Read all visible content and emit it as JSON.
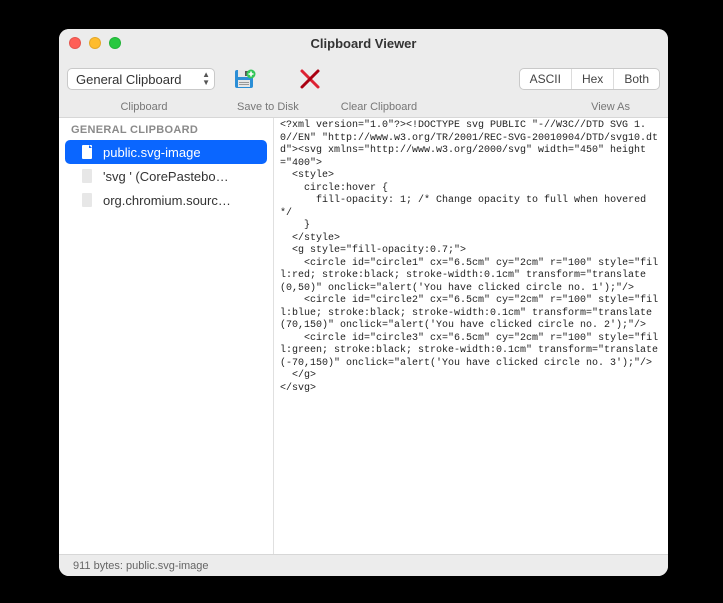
{
  "window": {
    "title": "Clipboard Viewer"
  },
  "toolbar": {
    "clipboard_select": "General Clipboard",
    "save_label": "Save to Disk",
    "clear_label": "Clear Clipboard",
    "label_clipboard": "Clipboard",
    "label_viewas": "View As",
    "viewas": {
      "ascii": "ASCII",
      "hex": "Hex",
      "both": "Both"
    }
  },
  "sidebar": {
    "header": "GENERAL CLIPBOARD",
    "items": [
      {
        "label": "public.svg-image",
        "selected": true
      },
      {
        "label": "'svg ' (CorePastebo…",
        "selected": false
      },
      {
        "label": "org.chromium.sourc…",
        "selected": false
      }
    ]
  },
  "textpane": {
    "content": "<?xml version=\"1.0\"?><!DOCTYPE svg PUBLIC \"-//W3C//DTD SVG 1.0//EN\" \"http://www.w3.org/TR/2001/REC-SVG-20010904/DTD/svg10.dtd\"><svg xmlns=\"http://www.w3.org/2000/svg\" width=\"450\" height=\"400\">\n  <style>\n    circle:hover {\n      fill-opacity: 1; /* Change opacity to full when hovered */\n    }\n  </style>\n  <g style=\"fill-opacity:0.7;\">\n    <circle id=\"circle1\" cx=\"6.5cm\" cy=\"2cm\" r=\"100\" style=\"fill:red; stroke:black; stroke-width:0.1cm\" transform=\"translate(0,50)\" onclick=\"alert('You have clicked circle no. 1');\"/>\n    <circle id=\"circle2\" cx=\"6.5cm\" cy=\"2cm\" r=\"100\" style=\"fill:blue; stroke:black; stroke-width:0.1cm\" transform=\"translate(70,150)\" onclick=\"alert('You have clicked circle no. 2');\"/>\n    <circle id=\"circle3\" cx=\"6.5cm\" cy=\"2cm\" r=\"100\" style=\"fill:green; stroke:black; stroke-width:0.1cm\" transform=\"translate(-70,150)\" onclick=\"alert('You have clicked circle no. 3');\"/>\n  </g>\n</svg>"
  },
  "status": {
    "text": "911 bytes: public.svg-image"
  }
}
